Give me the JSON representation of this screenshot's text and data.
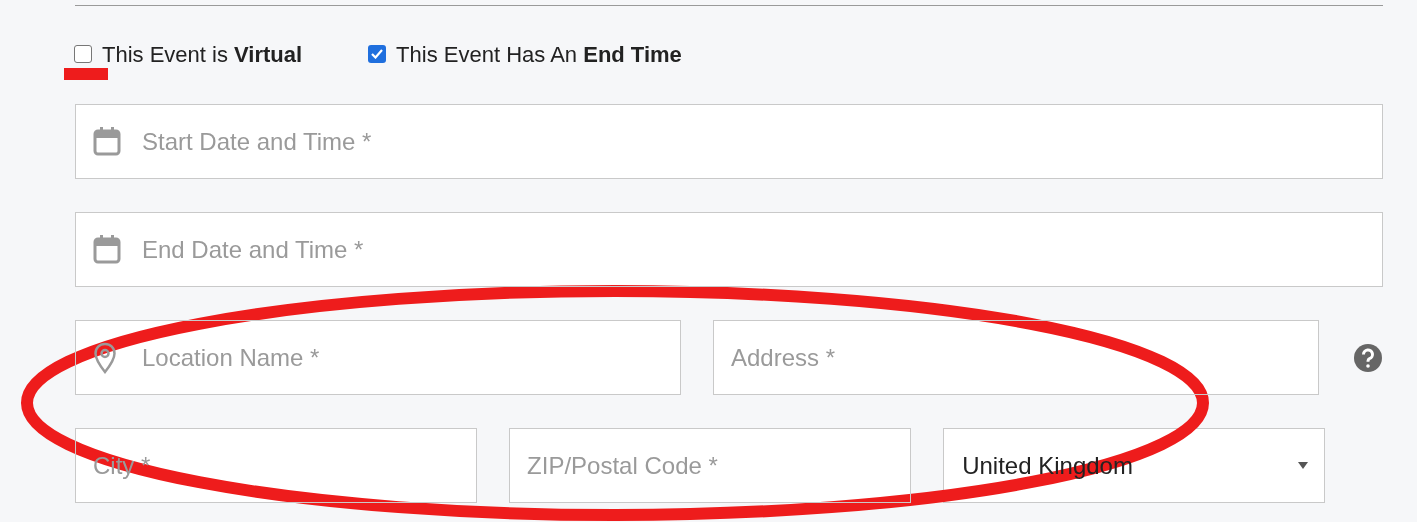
{
  "checkboxes": [
    {
      "label": "This Event is **Virtual**",
      "checked": false
    },
    {
      "label": "This Event Has An **End Time**",
      "checked": true
    }
  ],
  "rows": [
    {
      "help": false,
      "fields": [
        {
          "kind": "date",
          "placeholder": "Start Date and Time *"
        }
      ]
    },
    {
      "help": false,
      "fields": [
        {
          "kind": "date",
          "placeholder": "End Date and Time *"
        }
      ]
    },
    {
      "help": true,
      "fields": [
        {
          "kind": "location",
          "placeholder": "Location Name *"
        },
        {
          "kind": "text",
          "placeholder": "Address *"
        }
      ]
    },
    {
      "help": false,
      "fields": [
        {
          "kind": "text",
          "placeholder": "City *"
        },
        {
          "kind": "text",
          "placeholder": "ZIP/Postal Code *"
        },
        {
          "kind": "select",
          "value": "United Kingdom"
        }
      ]
    }
  ]
}
